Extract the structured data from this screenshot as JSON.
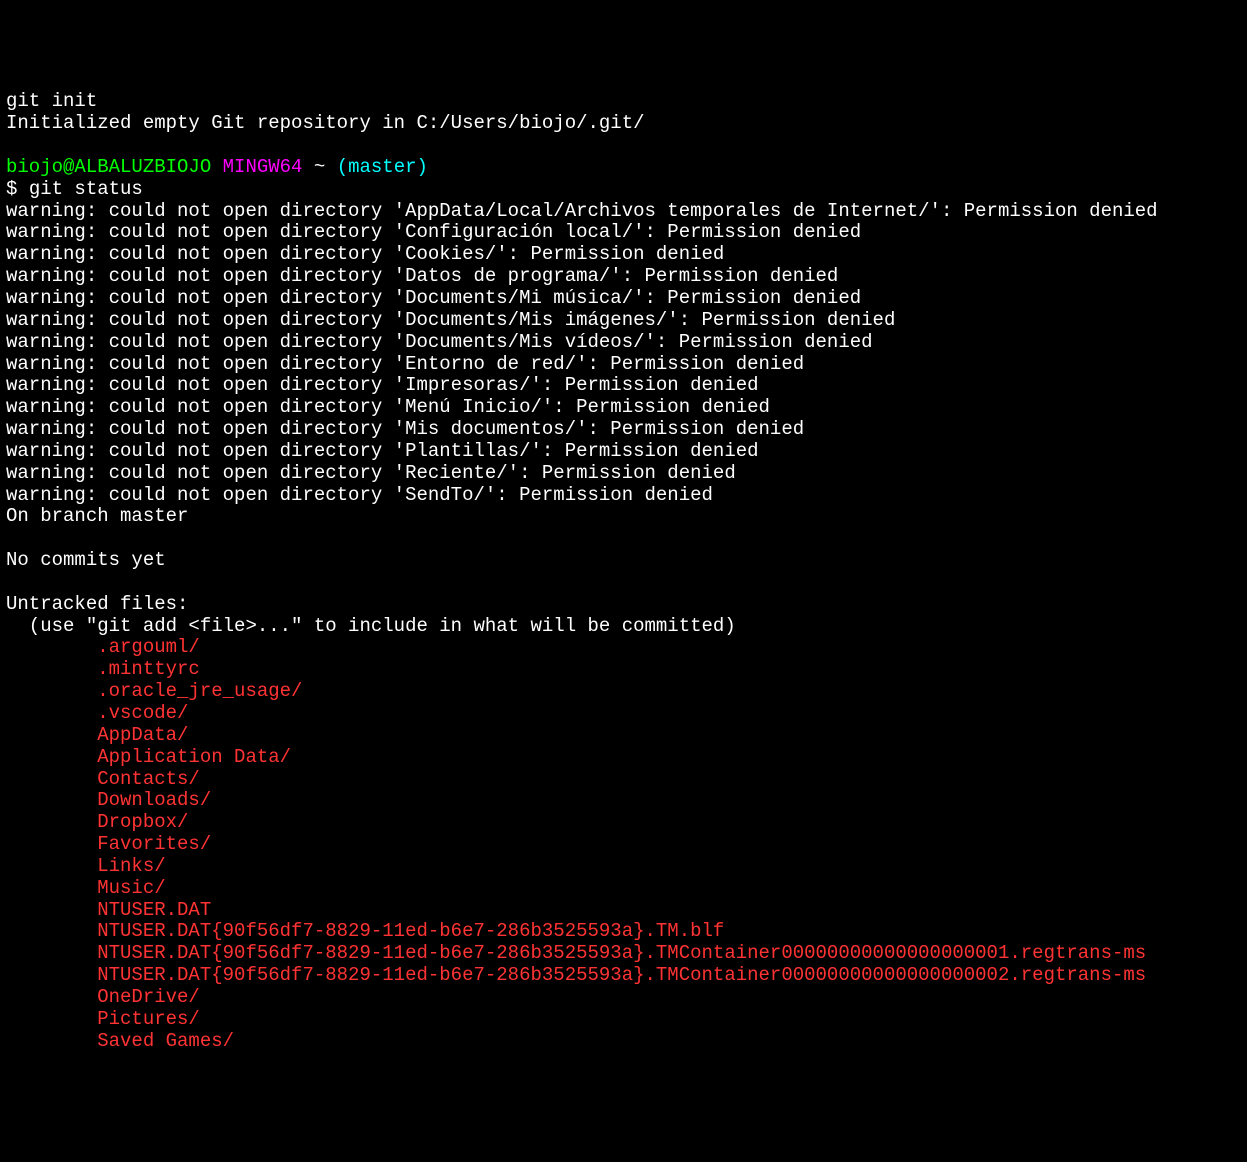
{
  "line1": "git init",
  "line2": "Initialized empty Git repository in C:/Users/biojo/.git/",
  "prompt": {
    "user": "biojo@ALBALUZBIOJO",
    "env": "MINGW64",
    "path": "~",
    "branch": "(master)"
  },
  "dollar": "$ ",
  "cmd": "git status",
  "warnings": [
    "warning: could not open directory 'AppData/Local/Archivos temporales de Internet/': Permission denied",
    "warning: could not open directory 'Configuración local/': Permission denied",
    "warning: could not open directory 'Cookies/': Permission denied",
    "warning: could not open directory 'Datos de programa/': Permission denied",
    "warning: could not open directory 'Documents/Mi música/': Permission denied",
    "warning: could not open directory 'Documents/Mis imágenes/': Permission denied",
    "warning: could not open directory 'Documents/Mis vídeos/': Permission denied",
    "warning: could not open directory 'Entorno de red/': Permission denied",
    "warning: could not open directory 'Impresoras/': Permission denied",
    "warning: could not open directory 'Menú Inicio/': Permission denied",
    "warning: could not open directory 'Mis documentos/': Permission denied",
    "warning: could not open directory 'Plantillas/': Permission denied",
    "warning: could not open directory 'Reciente/': Permission denied",
    "warning: could not open directory 'SendTo/': Permission denied"
  ],
  "onbranch": "On branch master",
  "nocommits": "No commits yet",
  "untracked_header": "Untracked files:",
  "untracked_hint": "  (use \"git add <file>...\" to include in what will be committed)",
  "untracked_files": [
    ".argouml/",
    ".minttyrc",
    ".oracle_jre_usage/",
    ".vscode/",
    "AppData/",
    "Application Data/",
    "Contacts/",
    "Downloads/",
    "Dropbox/",
    "Favorites/",
    "Links/",
    "Music/",
    "NTUSER.DAT",
    "NTUSER.DAT{90f56df7-8829-11ed-b6e7-286b3525593a}.TM.blf",
    "NTUSER.DAT{90f56df7-8829-11ed-b6e7-286b3525593a}.TMContainer00000000000000000001.regtrans-ms",
    "NTUSER.DAT{90f56df7-8829-11ed-b6e7-286b3525593a}.TMContainer00000000000000000002.regtrans-ms",
    "OneDrive/",
    "Pictures/",
    "Saved Games/"
  ],
  "indent": "        "
}
